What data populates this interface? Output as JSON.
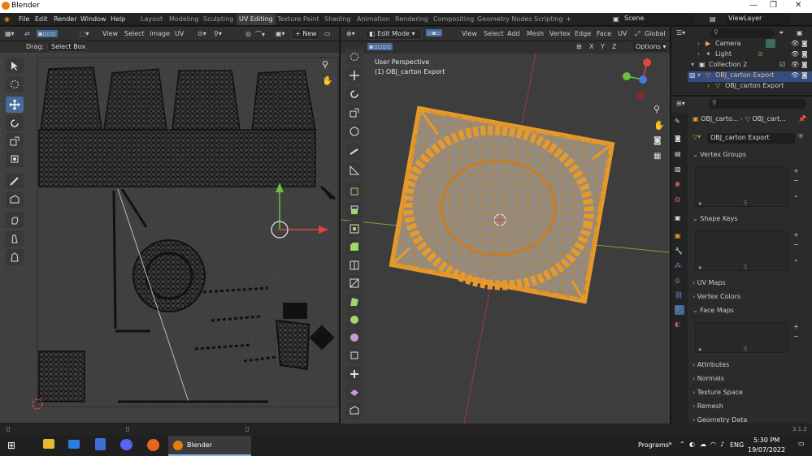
{
  "window": {
    "title": "Blender"
  },
  "menu": {
    "items": [
      "File",
      "Edit",
      "Render",
      "Window",
      "Help"
    ]
  },
  "workspaces": [
    "Layout",
    "Modeling",
    "Sculpting",
    "UV Editing",
    "Texture Paint",
    "Shading",
    "Animation",
    "Rendering",
    "Compositing",
    "Geometry Nodes",
    "Scripting"
  ],
  "active_workspace": "UV Editing",
  "scene": {
    "label": "Scene",
    "view_layer": "ViewLayer"
  },
  "uv_editor": {
    "view": "View",
    "select": "Select",
    "image": "Image",
    "uv": "UV",
    "new_label": "New",
    "drag_label": "Drag:",
    "drag_value": "Select Box"
  },
  "viewport": {
    "mode": "Edit Mode",
    "menus": [
      "View",
      "Select",
      "Add",
      "Mesh",
      "Vertex",
      "Edge",
      "Face",
      "UV"
    ],
    "orientation": "Global",
    "options": "Options",
    "perspective": "User Perspective",
    "object_label": "(1) OBJ_carton Export",
    "axes": {
      "x": "X",
      "y": "Y",
      "z": "Z"
    }
  },
  "outliner": {
    "rows": [
      {
        "label": "Camera"
      },
      {
        "label": "Light"
      },
      {
        "label": "Collection 2"
      },
      {
        "label": "OBJ_carton Export"
      },
      {
        "label": "OBJ_carton Export"
      }
    ]
  },
  "properties": {
    "breadcrumb_obj": "OBJ_carto...",
    "breadcrumb_mesh": "OBJ_cart...",
    "mesh_name": "OBJ_carton Export",
    "panels": [
      "Vertex Groups",
      "Shape Keys",
      "UV Maps",
      "Vertex Colors",
      "Face Maps",
      "Attributes",
      "Normals",
      "Texture Space",
      "Remesh",
      "Geometry Data"
    ]
  },
  "status": {
    "version": "3.1.2"
  },
  "taskbar": {
    "active_app": "Blender",
    "programs": "Programs",
    "lang": "ENG",
    "time": "5:30 PM",
    "date": "19/07/2022"
  },
  "colors": {
    "accent": "#4772b3",
    "mesh": "#e59a2d",
    "bg": "#404040"
  }
}
